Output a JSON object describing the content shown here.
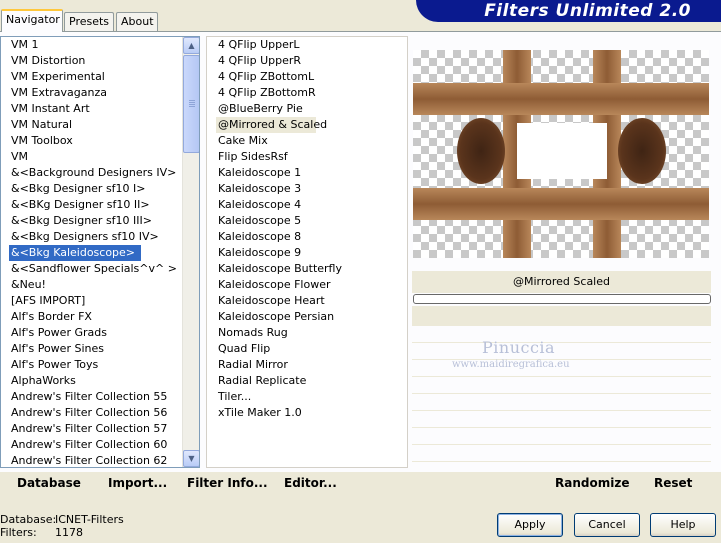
{
  "app": {
    "title": "Filters Unlimited 2.0"
  },
  "tabs": [
    {
      "label": "Navigator"
    },
    {
      "label": "Presets"
    },
    {
      "label": "About"
    }
  ],
  "categories": {
    "items": [
      "VM 1",
      "VM Distortion",
      "VM Experimental",
      "VM Extravaganza",
      "VM Instant Art",
      "VM Natural",
      "VM Toolbox",
      "VM",
      "&<Background Designers IV>",
      "&<Bkg Designer sf10 I>",
      "&<BKg Designer sf10 II>",
      "&<Bkg Designer sf10 III>",
      "&<Bkg Designers sf10 IV>",
      "&<Bkg Kaleidoscope>",
      "&<Sandflower Specials^v^ >",
      "&Neu!",
      "[AFS IMPORT]",
      "Alf's Border FX",
      "Alf's Power Grads",
      "Alf's Power Sines",
      "Alf's Power Toys",
      "AlphaWorks",
      "Andrew's Filter Collection 55",
      "Andrew's Filter Collection 56",
      "Andrew's Filter Collection 57",
      "Andrew's Filter Collection 60",
      "Andrew's Filter Collection 62"
    ],
    "selected_index": 13
  },
  "filters": {
    "items": [
      "4 QFlip UpperL",
      "4 QFlip UpperR",
      "4 QFlip ZBottomL",
      "4 QFlip ZBottomR",
      "@BlueBerry Pie",
      "@Mirrored & Scaled",
      "Cake Mix",
      "Flip SidesRsf",
      "Kaleidoscope 1",
      "Kaleidoscope 3",
      "Kaleidoscope 4",
      "Kaleidoscope 5",
      "Kaleidoscope 8",
      "Kaleidoscope 9",
      "Kaleidoscope Butterfly",
      "Kaleidoscope Flower",
      "Kaleidoscope Heart",
      "Kaleidoscope Persian",
      "Nomads Rug",
      "Quad Flip",
      "Radial Mirror",
      "Radial Replicate",
      "Tiler...",
      "xTile Maker 1.0"
    ],
    "selected_index": 5
  },
  "preview": {
    "filter_name": "@Mirrored  Scaled",
    "watermark_name": "Pinuccia",
    "watermark_url": "www.maidiregrafica.eu"
  },
  "commands": {
    "database": "Database",
    "import": "Import...",
    "filter_info": "Filter Info...",
    "editor": "Editor...",
    "randomize": "Randomize",
    "reset": "Reset"
  },
  "status": {
    "database_label": "Database:",
    "database_value": "ICNET-Filters",
    "filters_label": "Filters:",
    "filters_value": "1178"
  },
  "buttons": {
    "apply": "Apply",
    "cancel": "Cancel",
    "help": "Help"
  },
  "colors": {
    "banner": "#0a1a8f",
    "selection": "#316ac5",
    "preview_brown": "#8e5c35"
  }
}
